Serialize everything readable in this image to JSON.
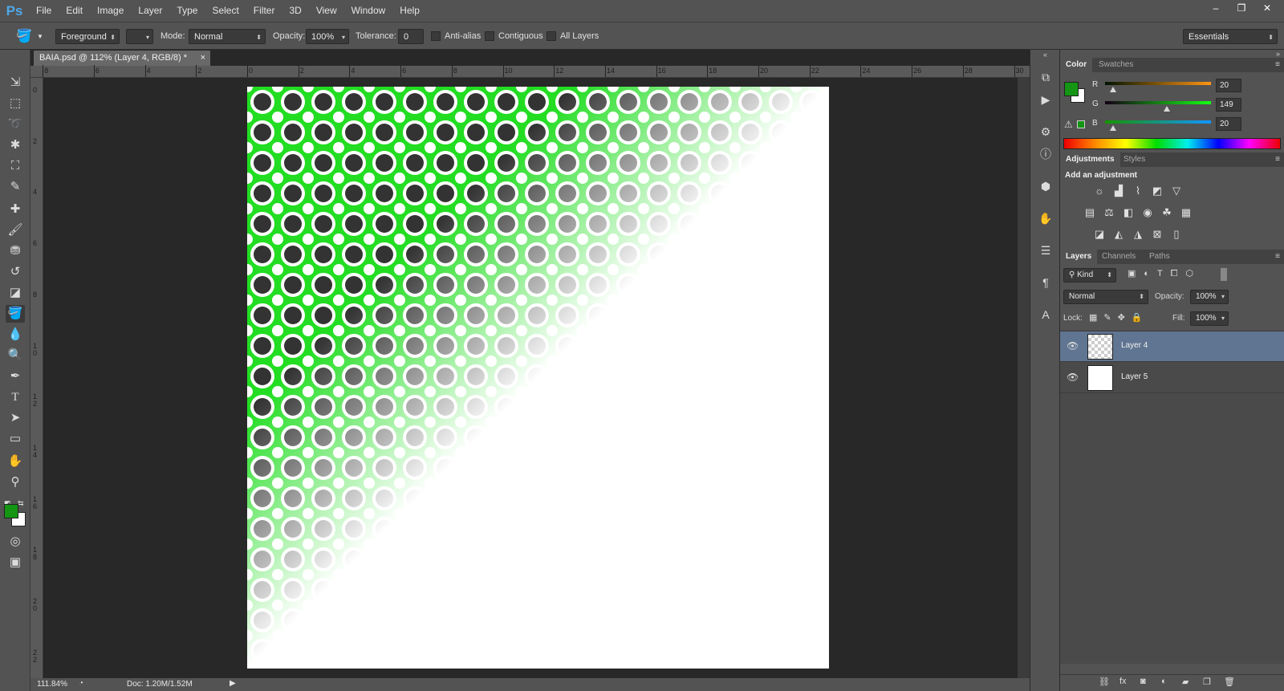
{
  "app": {
    "logo": "Ps",
    "menu": [
      "File",
      "Edit",
      "Image",
      "Layer",
      "Type",
      "Select",
      "Filter",
      "3D",
      "View",
      "Window",
      "Help"
    ],
    "window_controls": [
      "–",
      "❐",
      "✕"
    ]
  },
  "options_bar": {
    "fill_source": "Foreground",
    "mode_label": "Mode:",
    "mode_value": "Normal",
    "opacity_label": "Opacity:",
    "opacity_value": "100%",
    "tolerance_label": "Tolerance:",
    "tolerance_value": "0",
    "anti_alias_label": "Anti-alias",
    "contiguous_label": "Contiguous",
    "all_layers_label": "All Layers",
    "workspace": "Essentials"
  },
  "document": {
    "tab_title": "BAIA.psd @ 112% (Layer 4, RGB/8) *",
    "tab_close": "×",
    "ruler_top_labels": [
      "8",
      "6",
      "4",
      "2",
      "0",
      "2",
      "4",
      "6",
      "8",
      "10",
      "12",
      "14",
      "16",
      "18",
      "20",
      "22",
      "24",
      "26",
      "28",
      "30"
    ],
    "ruler_left_labels": [
      "0",
      "2",
      "4",
      "6",
      "8",
      "1\n0",
      "1\n2",
      "1\n4",
      "1\n6",
      "1\n8",
      "2\n0",
      "2\n2"
    ]
  },
  "status_bar": {
    "zoom": "111.84%",
    "doc_size": "Doc: 1.20M/1.52M",
    "arrow": "▶"
  },
  "colors": {
    "foreground": "#149514",
    "background": "#ffffff",
    "pattern_green": "#22dd22",
    "selected_layer": "#5f7591"
  },
  "color_panel": {
    "tabs": [
      "Color",
      "Swatches"
    ],
    "channels": [
      {
        "label": "R",
        "value": "20",
        "fraction": 0.078
      },
      {
        "label": "G",
        "value": "149",
        "fraction": 0.584
      },
      {
        "label": "B",
        "value": "20",
        "fraction": 0.078
      }
    ]
  },
  "adjustments_panel": {
    "tabs": [
      "Adjustments",
      "Styles"
    ],
    "heading": "Add an adjustment",
    "icons": [
      [
        "brightness-contrast-icon",
        "levels-icon",
        "curves-icon",
        "exposure-icon",
        "gradient-triangle-icon"
      ],
      [
        "vibrance-icon",
        "color-balance-icon",
        "black-white-icon",
        "photo-filter-icon",
        "channel-mixer-icon",
        "color-lookup-icon"
      ],
      [
        "invert-icon",
        "posterize-icon",
        "threshold-icon",
        "selective-color-icon",
        "gradient-map-icon"
      ]
    ]
  },
  "layers_panel": {
    "tabs": [
      "Layers",
      "Channels",
      "Paths"
    ],
    "filter_kind": "Kind",
    "blend_mode": "Normal",
    "opacity_label": "Opacity:",
    "opacity_value": "100%",
    "lock_label": "Lock:",
    "fill_label": "Fill:",
    "fill_value": "100%",
    "layers": [
      {
        "name": "Layer 4",
        "selected": true,
        "transparent": true
      },
      {
        "name": "Layer 5",
        "selected": false,
        "transparent": false
      }
    ],
    "footer_icons": [
      "link-icon",
      "fx-icon",
      "mask-icon",
      "adjustment-layer-icon",
      "folder-icon",
      "new-layer-icon",
      "trash-icon"
    ]
  }
}
